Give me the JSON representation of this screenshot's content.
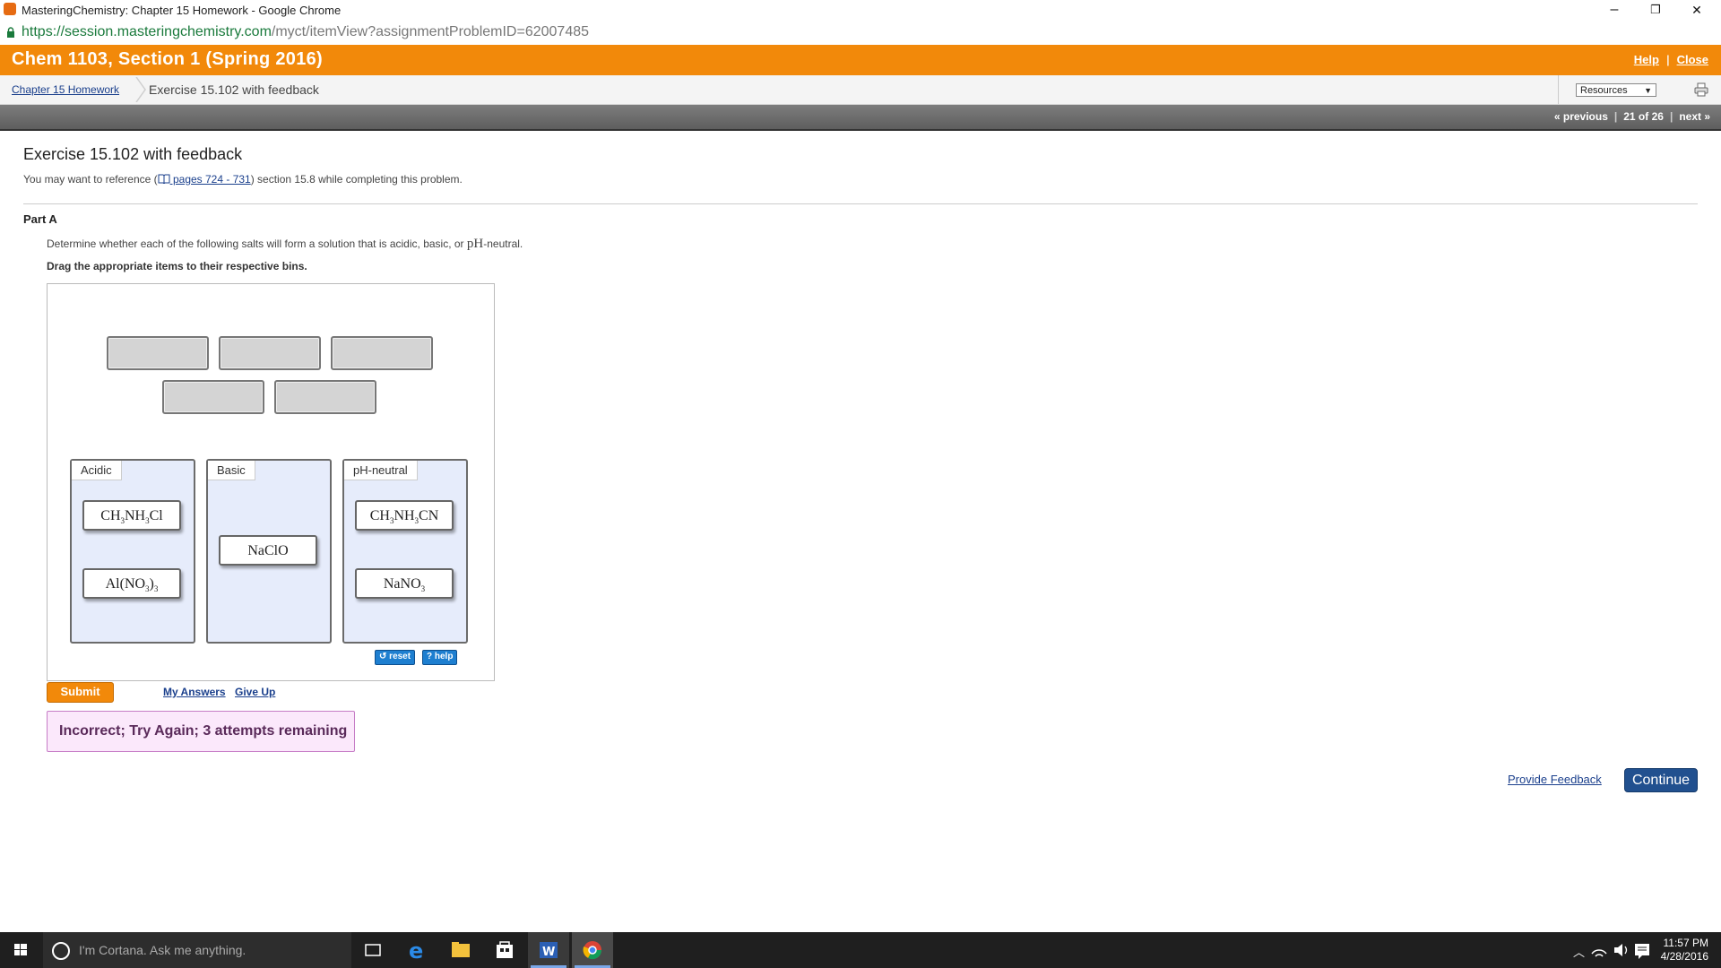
{
  "browser": {
    "window_title": "MasteringChemistry: Chapter 15 Homework - Google Chrome",
    "url_host": "https://session.masteringchemistry.com",
    "url_path": "/myct/itemView?assignmentProblemID=62007485",
    "minimize": "–",
    "restore": "❐",
    "close": "✕"
  },
  "header": {
    "course": "Chem 1103, Section 1 (Spring 2016)",
    "help": "Help",
    "close": "Close"
  },
  "breadcrumb": {
    "parent": "Chapter 15 Homework",
    "current": "Exercise 15.102 with feedback",
    "resources": "Resources"
  },
  "nav": {
    "previous": "« previous",
    "position": "21 of 26",
    "next": "next »"
  },
  "exercise": {
    "title": "Exercise 15.102 with feedback",
    "ref_prefix": "You may want to reference (",
    "ref_link": " pages 724 - 731",
    "ref_suffix": ") section 15.8 while completing this problem.",
    "part": "Part A",
    "instr_prefix": "Determine whether each of the following salts will form a solution that is acidic, basic, or ",
    "instr_ph": "pH",
    "instr_suffix": "-neutral.",
    "drag": "Drag the appropriate items to their respective bins."
  },
  "bins": {
    "acidic": "Acidic",
    "basic": "Basic",
    "neutral": "pH-neutral"
  },
  "tools": {
    "reset": "reset",
    "help": "? help"
  },
  "actions": {
    "submit": "Submit",
    "my_answers": "My Answers",
    "give_up": "Give Up"
  },
  "feedback": "Incorrect; Try Again; 3 attempts remaining",
  "footer": {
    "provide_feedback": "Provide Feedback",
    "continue": "Continue"
  },
  "taskbar": {
    "search_placeholder": "I'm Cortana. Ask me anything.",
    "time": "11:57 PM",
    "date": "4/28/2016"
  },
  "colors": {
    "course_orange": "#f2890a",
    "bin_fill": "#e6ecfb",
    "continue_blue": "#21508f"
  }
}
